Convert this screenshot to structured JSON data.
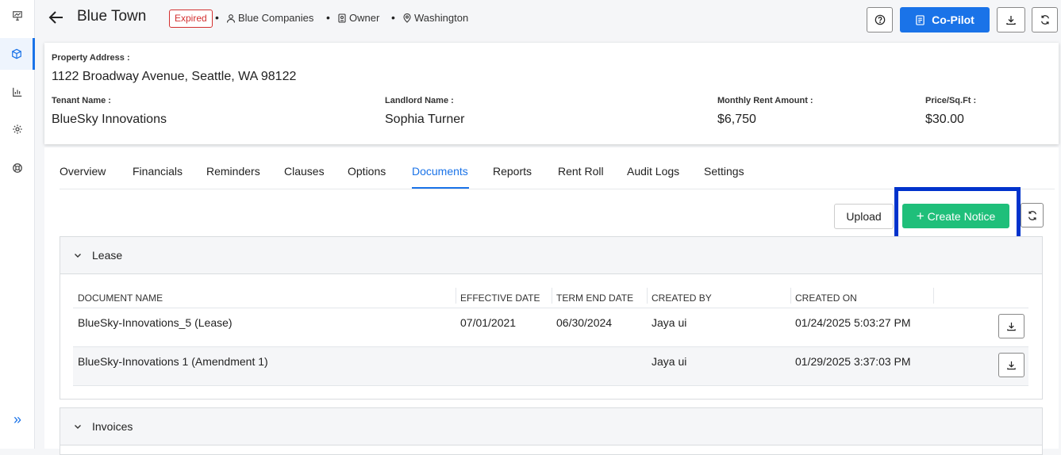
{
  "header": {
    "title": "Blue Town",
    "status_badge": "Expired",
    "company": "Blue Companies",
    "role": "Owner",
    "location": "Washington",
    "copilot_label": "Co-Pilot"
  },
  "property": {
    "address_label": "Property Address :",
    "address_value": "1122 Broadway Avenue, Seattle, WA 98122",
    "tenant_label": "Tenant Name :",
    "tenant_value": "BlueSky Innovations",
    "landlord_label": "Landlord Name :",
    "landlord_value": "Sophia Turner",
    "rent_label": "Monthly Rent Amount :",
    "rent_value": "$6,750",
    "price_label": "Price/Sq.Ft :",
    "price_value": "$30.00"
  },
  "tabs": [
    {
      "label": "Overview"
    },
    {
      "label": "Financials"
    },
    {
      "label": "Reminders"
    },
    {
      "label": "Clauses"
    },
    {
      "label": "Options"
    },
    {
      "label": "Documents"
    },
    {
      "label": "Reports"
    },
    {
      "label": "Rent Roll"
    },
    {
      "label": "Audit Logs"
    },
    {
      "label": "Settings"
    }
  ],
  "active_tab": "Documents",
  "actions": {
    "upload_label": "Upload",
    "create_notice_label": "Create Notice"
  },
  "lease_section": {
    "title": "Lease",
    "columns": [
      "DOCUMENT NAME",
      "EFFECTIVE DATE",
      "TERM END DATE",
      "CREATED BY",
      "CREATED ON"
    ],
    "rows": [
      {
        "name": "BlueSky-Innovations_5 (Lease)",
        "effective": "07/01/2021",
        "term_end": "06/30/2024",
        "created_by": "Jaya ui",
        "created_on": "01/24/2025 5:03:27 PM"
      },
      {
        "name": "BlueSky-Innovations 1 (Amendment 1)",
        "effective": "",
        "term_end": "",
        "created_by": "Jaya ui",
        "created_on": "01/29/2025 3:37:03 PM"
      }
    ]
  },
  "invoices_section": {
    "title": "Invoices"
  },
  "colors": {
    "accent": "#1a73e8",
    "create_notice": "#1fbf7a",
    "expired": "#d32f2f",
    "highlight_box": "#0033cc"
  }
}
